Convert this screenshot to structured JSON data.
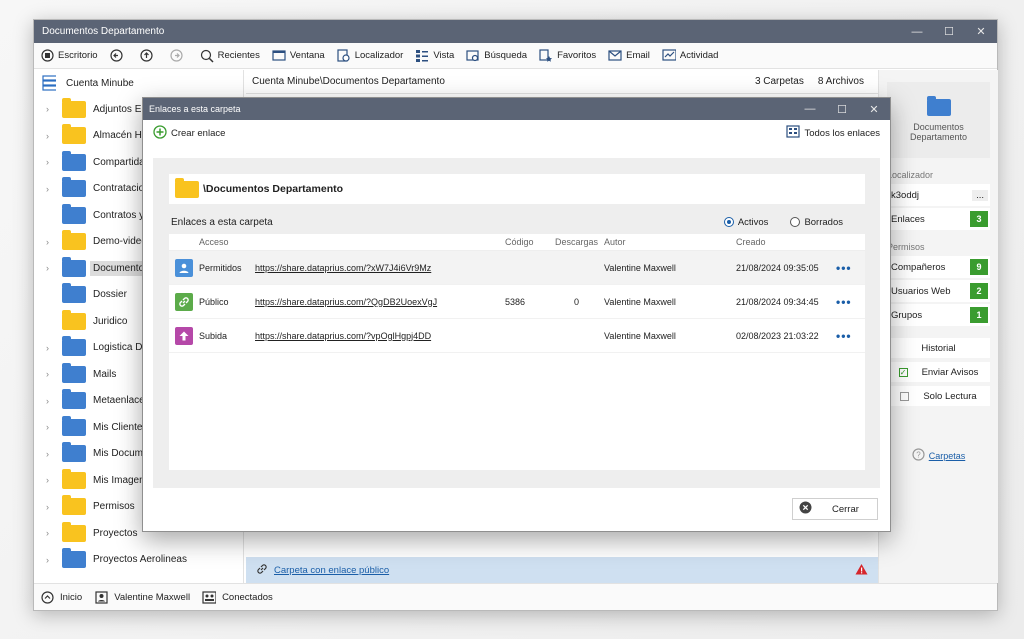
{
  "window": {
    "title": "Documentos Departamento"
  },
  "toolbar": {
    "items": [
      {
        "label": "Escritorio",
        "icon": "desktop-icon"
      },
      {
        "label": "",
        "icon": "back-icon"
      },
      {
        "label": "",
        "icon": "up-icon"
      },
      {
        "label": "",
        "icon": "forward-icon"
      },
      {
        "label": "Recientes",
        "icon": "recent-icon"
      },
      {
        "label": "Ventana",
        "icon": "window-icon"
      },
      {
        "label": "Localizador",
        "icon": "locator-icon"
      },
      {
        "label": "Vista",
        "icon": "view-icon"
      },
      {
        "label": "Búsqueda",
        "icon": "search-icon"
      },
      {
        "label": "Favoritos",
        "icon": "favorites-icon"
      },
      {
        "label": "Email",
        "icon": "email-icon"
      },
      {
        "label": "Actividad",
        "icon": "activity-icon"
      }
    ]
  },
  "tree": {
    "root": "Cuenta Minube",
    "items": [
      {
        "label": "Adjuntos Em",
        "color": "#f9c31f",
        "expandable": true
      },
      {
        "label": "Almacén His",
        "color": "#f9c31f",
        "expandable": true
      },
      {
        "label": "Compartida",
        "color": "#3f7fcf",
        "expandable": true
      },
      {
        "label": "Contratacion",
        "color": "#3f7fcf",
        "expandable": true
      },
      {
        "label": "Contratos y",
        "color": "#3f7fcf",
        "expandable": false
      },
      {
        "label": "Demo-video",
        "color": "#f9c31f",
        "expandable": true
      },
      {
        "label": "Documentos",
        "color": "#3f7fcf",
        "expandable": true,
        "selected": true
      },
      {
        "label": "Dossier",
        "color": "#3f7fcf",
        "expandable": false
      },
      {
        "label": "Juridico",
        "color": "#f9c31f",
        "expandable": false
      },
      {
        "label": "Logistica Dis",
        "color": "#3f7fcf",
        "expandable": true
      },
      {
        "label": "Mails",
        "color": "#3f7fcf",
        "expandable": true
      },
      {
        "label": "Metaenlaces",
        "color": "#3f7fcf",
        "expandable": true
      },
      {
        "label": "Mis Clientes",
        "color": "#3f7fcf",
        "expandable": true
      },
      {
        "label": "Mis Docume",
        "color": "#3f7fcf",
        "expandable": true
      },
      {
        "label": "Mis Imagene",
        "color": "#f9c31f",
        "expandable": true
      },
      {
        "label": "Permisos",
        "color": "#f9c31f",
        "expandable": true
      },
      {
        "label": "Proyectos",
        "color": "#f9c31f",
        "expandable": true
      },
      {
        "label": "Proyectos Aerolineas",
        "color": "#3f7fcf",
        "expandable": true
      }
    ]
  },
  "center": {
    "path": "Cuenta Minube\\Documentos Departamento",
    "folders_count": "3 Carpetas",
    "files_count": "8 Archivos",
    "banner_link": "Carpeta con enlace público"
  },
  "right_panel": {
    "card_title": "Documentos Departamento",
    "section_locator": "Localizador",
    "locator_value": "k3oddj",
    "locator_more": "...",
    "links_label": "Enlaces",
    "links_count": "3",
    "section_permissions": "Permisos",
    "perm_rows": [
      {
        "label": "Compañeros",
        "count": "9"
      },
      {
        "label": "Usuarios Web",
        "count": "2"
      },
      {
        "label": "Grupos",
        "count": "1"
      }
    ],
    "history": "Historial",
    "notify": "Enviar Avisos",
    "readonly": "Solo Lectura",
    "help_link": "Carpetas"
  },
  "statusbar": {
    "home": "Inicio",
    "user": "Valentine Maxwell",
    "connected": "Conectados"
  },
  "dialog": {
    "title": "Enlaces a esta carpeta",
    "create_link": "Crear enlace",
    "all_links": "Todos los enlaces",
    "folder_name": "\\Documentos Departamento",
    "section_label": "Enlaces a esta carpeta",
    "filter_active": "Activos",
    "filter_deleted": "Borrados",
    "columns": {
      "access": "Acceso",
      "code": "Código",
      "downloads": "Descargas",
      "author": "Autor",
      "created": "Creado"
    },
    "rows": [
      {
        "icon": "user-icon",
        "icon_color": "#4a90d9",
        "access": "Permitidos",
        "url": "https://share.dataprius.com/?xW7J4i6Vr9Mz",
        "code": "",
        "downloads": "",
        "author": "Valentine Maxwell",
        "created": "21/08/2024 09:35:05",
        "more": "•••"
      },
      {
        "icon": "link-icon",
        "icon_color": "#5cab4a",
        "access": "Público",
        "url": "https://share.dataprius.com/?QgDB2UoexVgJ",
        "code": "5386",
        "downloads": "0",
        "author": "Valentine Maxwell",
        "created": "21/08/2024 09:34:45",
        "more": "•••"
      },
      {
        "icon": "upload-icon",
        "icon_color": "#b548a8",
        "access": "Subida",
        "url": "https://share.dataprius.com/?vpOglHgpj4DD",
        "code": "",
        "downloads": "",
        "author": "Valentine Maxwell",
        "created": "02/08/2023 21:03:22",
        "more": "•••"
      }
    ],
    "close": "Cerrar"
  }
}
